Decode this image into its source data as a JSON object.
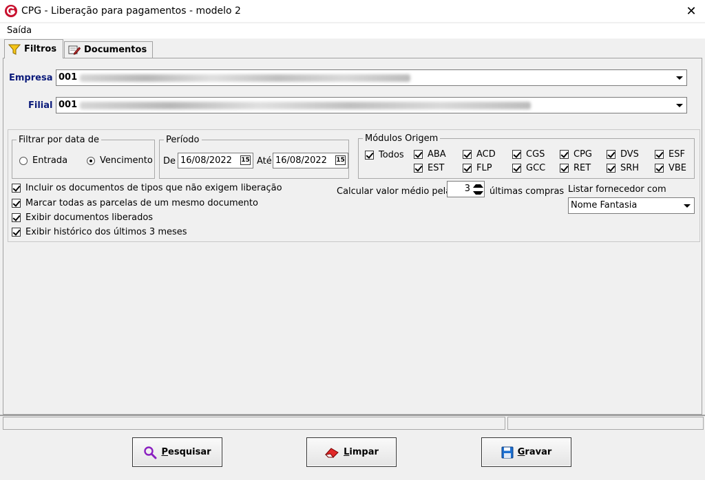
{
  "window": {
    "title": "CPG - Liberação para pagamentos - modelo 2",
    "close_glyph": "✕"
  },
  "menu": {
    "items": [
      "Saída"
    ]
  },
  "tabs": [
    {
      "label": "Filtros",
      "icon": "filter-icon",
      "active": true
    },
    {
      "label": "Documentos",
      "icon": "documents-icon",
      "active": false
    }
  ],
  "empresa": {
    "label": "Empresa",
    "value": "001"
  },
  "filial": {
    "label": "Filial",
    "value": "001"
  },
  "filtrar_data": {
    "title": "Filtrar por data de",
    "options": [
      {
        "label": "Entrada",
        "selected": false
      },
      {
        "label": "Vencimento",
        "selected": true
      }
    ]
  },
  "periodo": {
    "title": "Período",
    "de_label": "De",
    "de_value": "16/08/2022",
    "ate_label": "Até",
    "ate_value": "16/08/2022",
    "calendar_glyph": "15"
  },
  "modulos": {
    "title": "Módulos Origem",
    "todos": {
      "label": "Todos",
      "checked": true
    },
    "row1": [
      {
        "label": "ABA",
        "checked": true
      },
      {
        "label": "ACD",
        "checked": true
      },
      {
        "label": "CGS",
        "checked": true
      },
      {
        "label": "CPG",
        "checked": true
      },
      {
        "label": "DVS",
        "checked": true
      },
      {
        "label": "ESF",
        "checked": true
      }
    ],
    "row2": [
      {
        "label": "EST",
        "checked": true
      },
      {
        "label": "FLP",
        "checked": true
      },
      {
        "label": "GCC",
        "checked": true
      },
      {
        "label": "RET",
        "checked": true
      },
      {
        "label": "SRH",
        "checked": true
      },
      {
        "label": "VBE",
        "checked": true
      }
    ]
  },
  "options": [
    {
      "label": "Incluir os documentos de tipos que não exigem liberação",
      "checked": true
    },
    {
      "label": "Marcar todas as parcelas de um mesmo documento",
      "checked": true
    },
    {
      "label": "Exibir documentos liberados",
      "checked": true
    },
    {
      "label": "Exibir histórico dos últimos 3 meses",
      "checked": true
    }
  ],
  "calc_medio": {
    "prefix": "Calcular valor médio pelas",
    "value": "3",
    "suffix": "últimas compras"
  },
  "listar_fornecedor": {
    "label": "Listar fornecedor com",
    "value": "Nome Fantasia"
  },
  "buttons": {
    "pesquisar": {
      "mnemonic": "P",
      "rest": "esquisar"
    },
    "limpar": {
      "mnemonic": "L",
      "rest": "impar"
    },
    "gravar": {
      "mnemonic": "G",
      "rest": "ravar"
    }
  },
  "colors": {
    "label_blue": "#0a1a7a",
    "logo_red": "#c8102e"
  }
}
